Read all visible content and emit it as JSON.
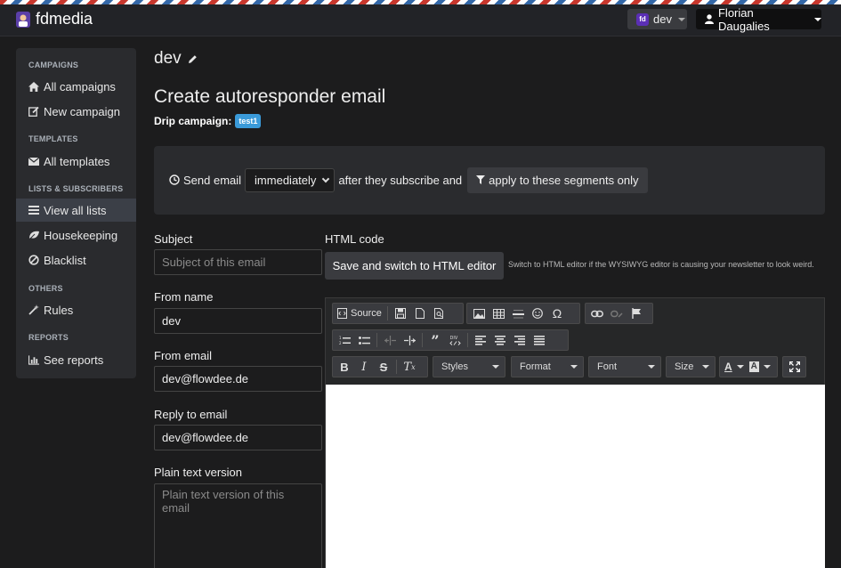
{
  "navbar": {
    "brand": "fdmedia",
    "workspace_badge": "fd",
    "workspace": "dev",
    "user": "Florian Daugalies"
  },
  "sidebar": {
    "sections": [
      {
        "title": "CAMPAIGNS",
        "items": [
          {
            "label": "All campaigns",
            "icon": "home-icon"
          },
          {
            "label": "New campaign",
            "icon": "edit-icon"
          }
        ]
      },
      {
        "title": "TEMPLATES",
        "items": [
          {
            "label": "All templates",
            "icon": "envelope-icon"
          }
        ]
      },
      {
        "title": "LISTS & SUBSCRIBERS",
        "items": [
          {
            "label": "View all lists",
            "icon": "list-icon",
            "active": true
          },
          {
            "label": "Housekeeping",
            "icon": "leaf-icon"
          },
          {
            "label": "Blacklist",
            "icon": "ban-icon"
          }
        ]
      },
      {
        "title": "OTHERS",
        "items": [
          {
            "label": "Rules",
            "icon": "wand-icon"
          }
        ]
      },
      {
        "title": "REPORTS",
        "items": [
          {
            "label": "See reports",
            "icon": "bar-chart-icon"
          }
        ]
      }
    ]
  },
  "page": {
    "app_name": "dev",
    "heading": "Create autoresponder email",
    "drip_label": "Drip campaign:",
    "drip_name": "test1"
  },
  "schedule": {
    "send_label": "Send email",
    "timing": "immediately",
    "after_label": "after they subscribe and",
    "segments_button": "apply to these segments only"
  },
  "form": {
    "subject_label": "Subject",
    "subject_placeholder": "Subject of this email",
    "from_name_label": "From name",
    "from_name": "dev",
    "from_email_label": "From email",
    "from_email": "dev@flowdee.de",
    "reply_to_label": "Reply to email",
    "reply_to": "dev@flowdee.de",
    "plain_text_label": "Plain text version",
    "plain_text_placeholder": "Plain text version of this email"
  },
  "html_section": {
    "label": "HTML code",
    "switch_button": "Save and switch to HTML editor",
    "hint": "Switch to HTML editor if the WYSIWYG editor is causing your newsletter to look weird."
  },
  "editor": {
    "source_label": "Source",
    "combos": [
      "Styles",
      "Format",
      "Font",
      "Size"
    ]
  },
  "colors": {
    "background": "#1c1c1d",
    "panel": "#2a2b2e",
    "badge": "#3a9ad9",
    "workspace_badge": "#5b2fb5"
  }
}
